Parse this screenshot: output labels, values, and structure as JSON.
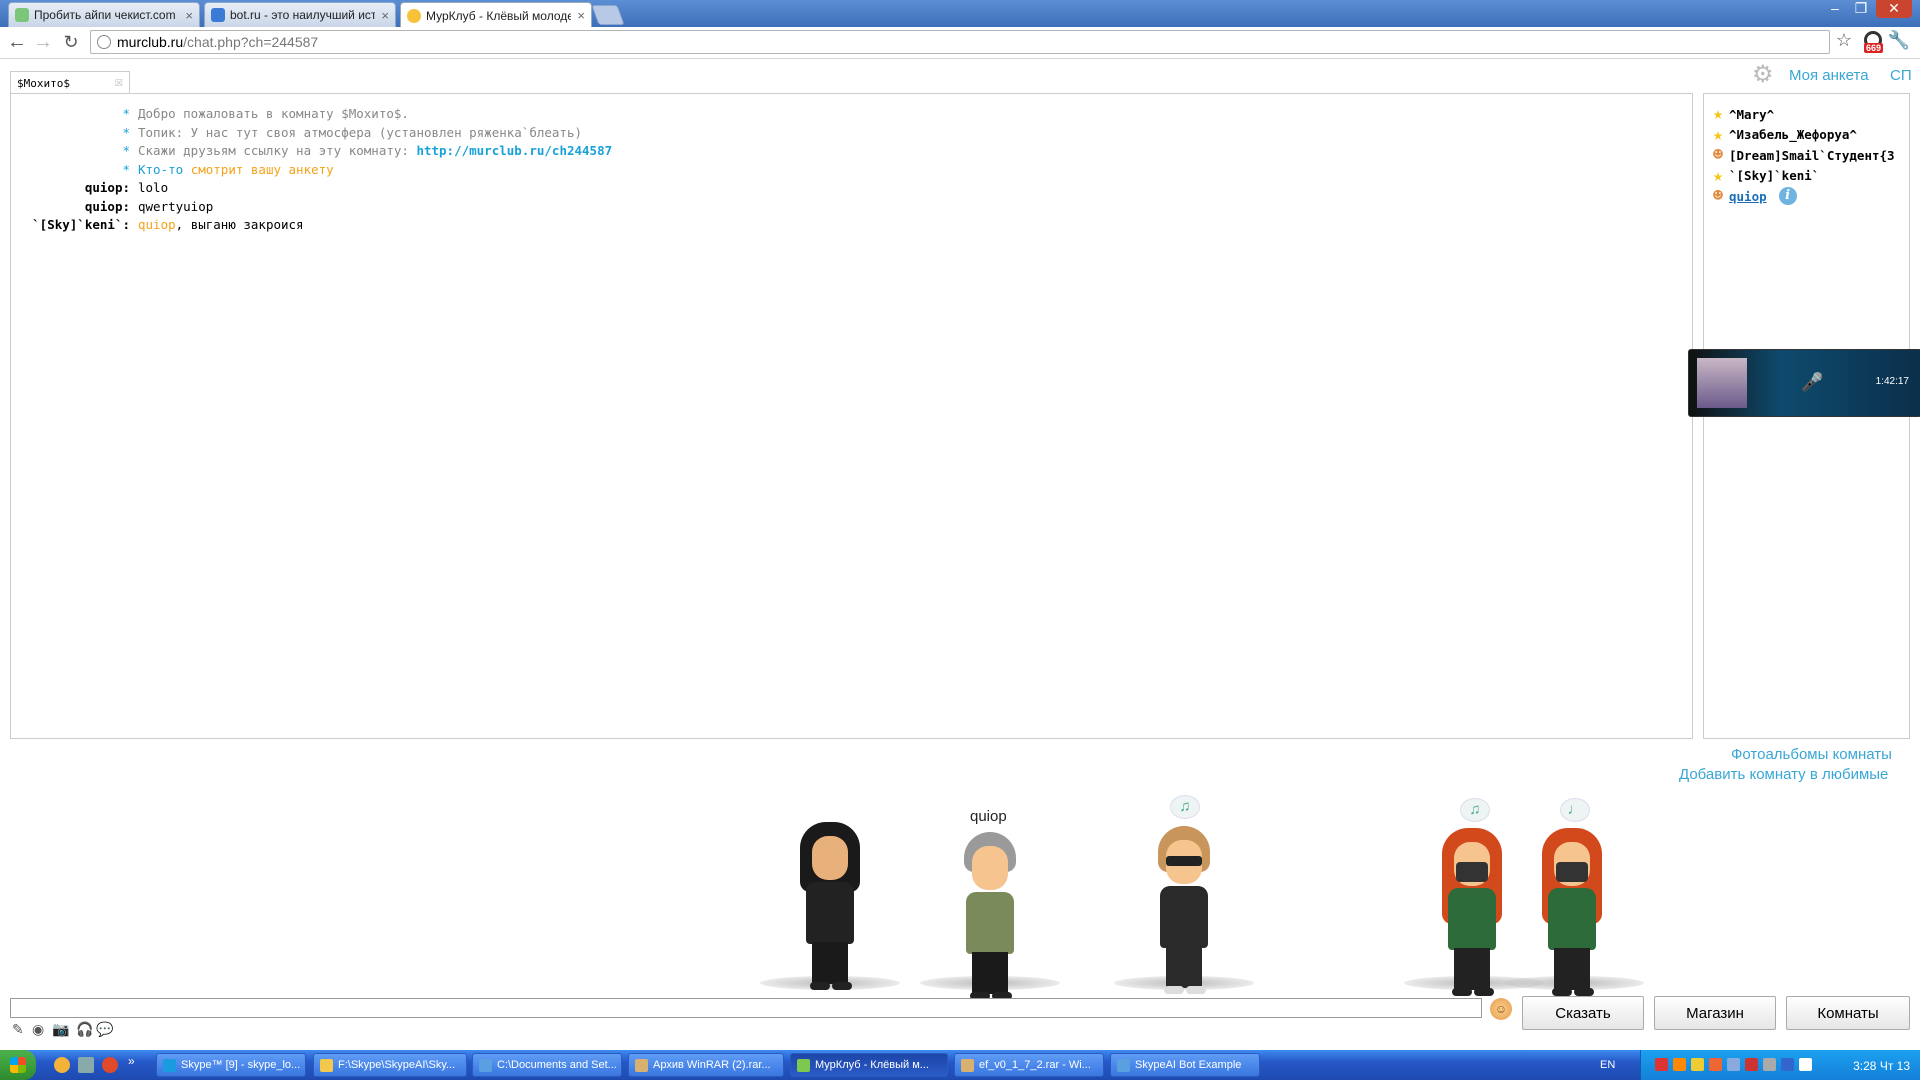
{
  "browser": {
    "tabs": [
      {
        "title": "Пробить айпи чекист.com",
        "active": false
      },
      {
        "title": "bot.ru - это наилучший исто",
        "active": false
      },
      {
        "title": "МурКлуб - Клёвый молодеж",
        "active": true
      }
    ],
    "url_host": "murclub.ru",
    "url_path": "/chat.php?ch=244587",
    "extension_badge": "669"
  },
  "page": {
    "room_tab": "$Мохито$",
    "header_links": {
      "my_profile": "Моя анкета",
      "sp": "СП"
    },
    "messages": [
      {
        "type": "system",
        "nick": "*",
        "text": "Добро пожаловать в комнату $Мохито$."
      },
      {
        "type": "system",
        "nick": "*",
        "text": "Топик: У нас тут своя атмосфера (установлен ряженка`блеать)"
      },
      {
        "type": "system",
        "nick": "*",
        "text": "Скажи друзьям ссылку на эту комнату: ",
        "link": "http://murclub.ru/ch244587"
      },
      {
        "type": "system",
        "nick": "*",
        "text_blue": "Кто-то ",
        "text_orange": "смотрит вашу анкету"
      },
      {
        "type": "chat",
        "nick": "quiop:",
        "text": "lolo"
      },
      {
        "type": "chat",
        "nick": "quiop:",
        "text": "qwertyuiop"
      },
      {
        "type": "chat",
        "nick": "`[Sky]`keni`:",
        "mention": "quiop",
        "text": ", выганю закроися"
      }
    ],
    "users": [
      {
        "name": "^Mary^",
        "icon": "star-icon"
      },
      {
        "name": "^Изабель_Жефоруа^",
        "icon": "star-icon"
      },
      {
        "name": "[Dream]Smail`Студент{3",
        "icon": "person-icon"
      },
      {
        "name": "`[Sky]`keni`",
        "icon": "star-icon"
      },
      {
        "name": "quiop",
        "icon": "person-icon",
        "self": true
      }
    ],
    "video_popup": {
      "time": "1:42:17"
    },
    "room_links": {
      "photo_albums": "Фотоальбомы комнаты",
      "add_favorite": "Добавить комнату в любимые"
    },
    "avatar_name": "quiop",
    "buttons": {
      "say": "Сказать",
      "shop": "Магазин",
      "rooms": "Комнаты"
    }
  },
  "taskbar": {
    "tasks": [
      {
        "title": "Skype™ [9] - skype_lo...",
        "active": false
      },
      {
        "title": "F:\\Skype\\SkypeAI\\Sky...",
        "active": false
      },
      {
        "title": "C:\\Documents and Set...",
        "active": false
      },
      {
        "title": "Архив WinRAR (2).rar...",
        "active": false
      },
      {
        "title": "МурКлуб - Клёвый м...",
        "active": true
      },
      {
        "title": "ef_v0_1_7_2.rar - Wi...",
        "active": false
      },
      {
        "title": "SkypeAI Bot Example",
        "active": false
      }
    ],
    "language": "EN",
    "clock": "3:28 Чт 13"
  },
  "colors": {
    "accent_link": "#3aa6d6",
    "highlight_orange": "#f4a21a",
    "taskbar": "#2658c8"
  }
}
